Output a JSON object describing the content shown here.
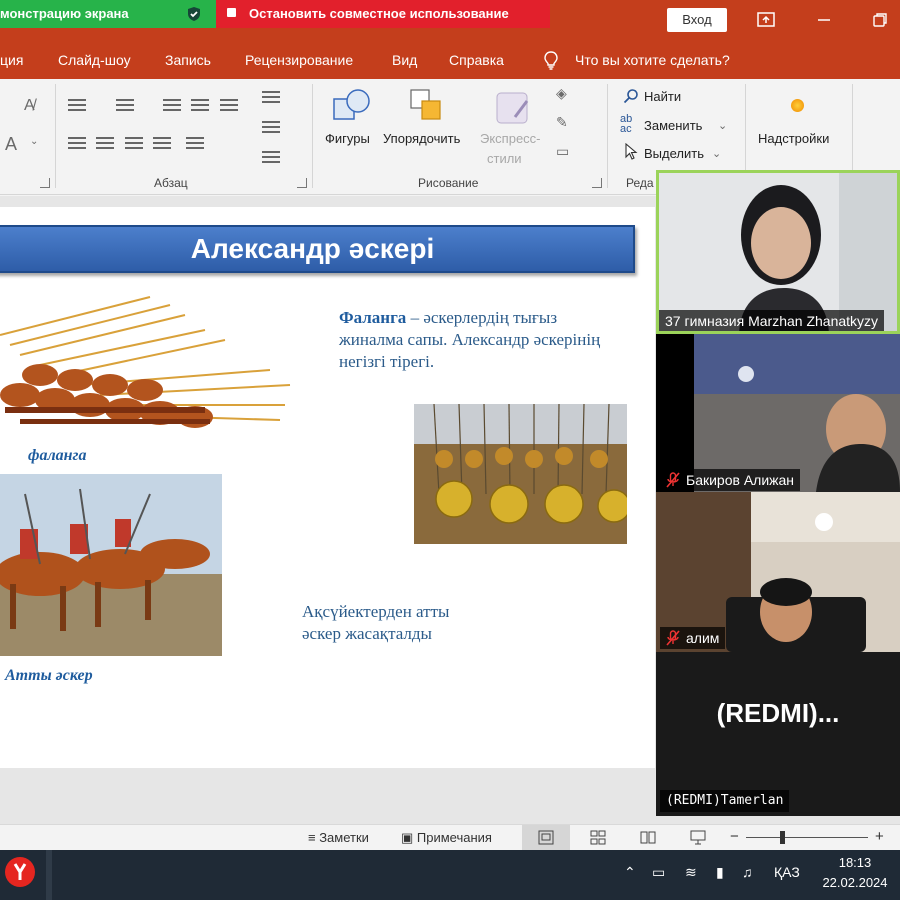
{
  "titlebar": {
    "screen_share_label": "монстрацию экрана",
    "stop_sharing_label": "Остановить совместное использование",
    "login_button": "Вход"
  },
  "menu": {
    "tabs": [
      "ция",
      "Слайд-шоу",
      "Запись",
      "Рецензирование",
      "Вид",
      "Справка"
    ],
    "tell_me": "Что вы хотите сделать?"
  },
  "ribbon": {
    "paragraph_group": "Абзац",
    "drawing_group": "Рисование",
    "editing_group_partial": "Реда",
    "shapes_label": "Фигуры",
    "arrange_label": "Упорядочить",
    "quick_styles_label_1": "Экспресс-",
    "quick_styles_label_2": "стили",
    "find_label": "Найти",
    "replace_label": "Заменить",
    "select_label": "Выделить",
    "addins_label": "Надстройки",
    "font_glyph": "A"
  },
  "slide": {
    "title": "Александр әскері",
    "phalanx_term": "Фаланга",
    "phalanx_rest": " – әскерлердің тығыз жиналма сапы. Александр әскерінің негізгі тірегі.",
    "phalanx_caption": "фаланга",
    "cavalry_text": "Ақсүйектерден атты әскер жасақталды",
    "cavalry_caption": "Атты әскер"
  },
  "participants": [
    {
      "name": "37 гимназия Marzhan Zhanatkyzy",
      "muted": false
    },
    {
      "name": "Бакиров Алижан",
      "muted": true
    },
    {
      "name": "алим",
      "muted": true
    },
    {
      "name": "(REDMI)Tamerlan",
      "muted": false,
      "avatar_text": "(REDMI)..."
    }
  ],
  "statusbar": {
    "notes_label": "Заметки",
    "comments_label": "Примечания"
  },
  "taskbar": {
    "language": "ҚАЗ",
    "time": "18:13",
    "date": "22.02.2024"
  },
  "colors": {
    "ribbon_accent": "#c43e1c",
    "share_green": "#27b34a",
    "share_red": "#e2202c",
    "slide_title_blue": "#3a6bbd",
    "active_speaker_border": "#9bd35a"
  }
}
